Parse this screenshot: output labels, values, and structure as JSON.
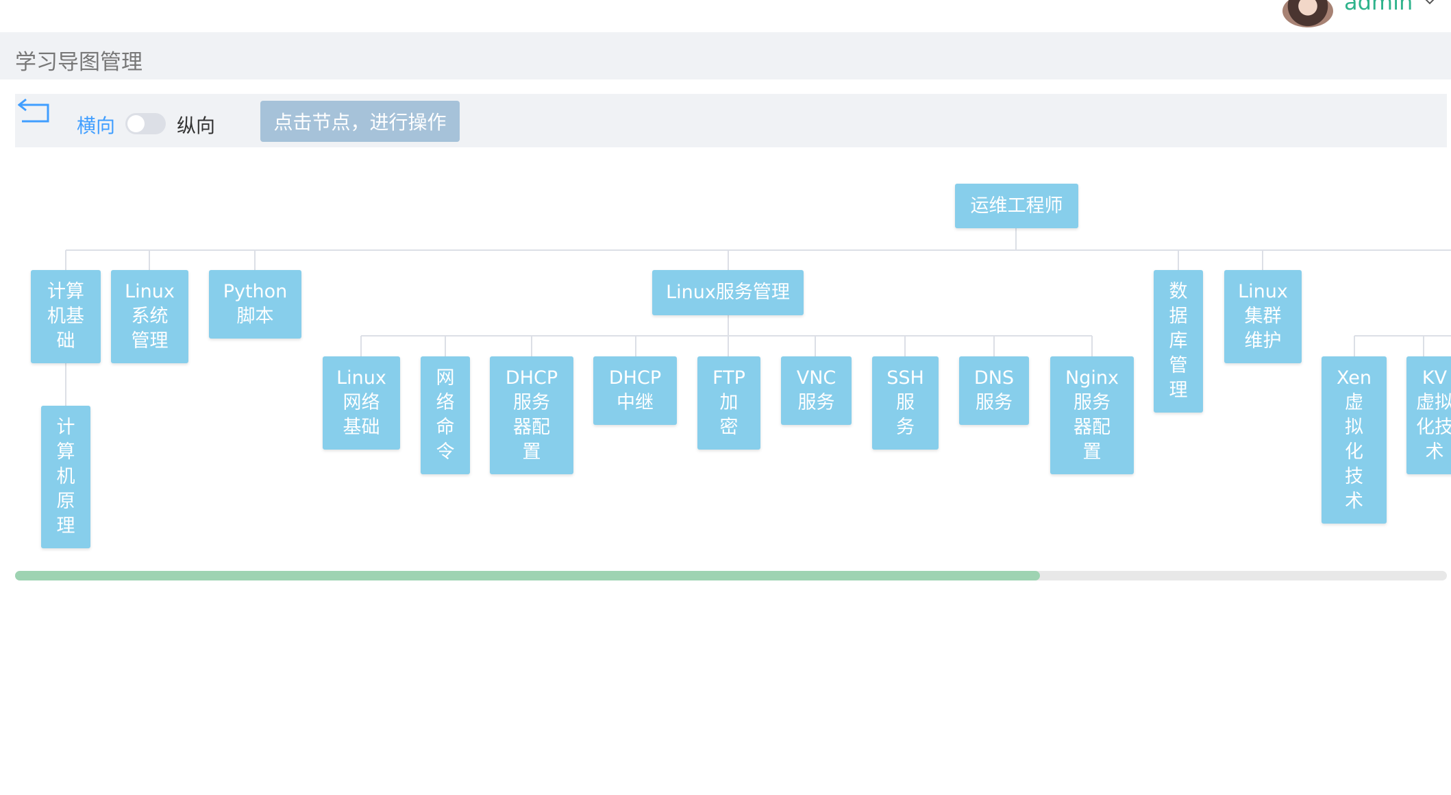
{
  "user": {
    "name": "admin"
  },
  "header": {
    "title": "学习导图管理"
  },
  "toolbar": {
    "horizontal_label": "横向",
    "vertical_label": "纵向",
    "hint": "点击节点，进行操作",
    "orientation_switch_on": false
  },
  "mindmap": {
    "root": "运维工程师",
    "nodes": {
      "computer_basics": "计算\n机基\n础",
      "computer_principles": "计\n算\n机\n原\n理",
      "linux_system": "Linux\n系统\n管理",
      "python": "Python\n脚本",
      "linux_services": "Linux服务管理",
      "linux_network": "Linux\n网络\n基础",
      "network_commands": "网\n络\n命\n令",
      "dhcp_server": "DHCP\n服务\n器配\n置",
      "dhcp_relay": "DHCP\n中继",
      "ftp": "FTP\n加\n密",
      "vnc": "VNC\n服务",
      "ssh": "SSH\n服\n务",
      "dns": "DNS\n服务",
      "nginx": "Nginx\n服务\n器配\n置",
      "database": "数\n据\n库\n管\n理",
      "linux_cluster": "Linux\n集群\n维护",
      "xen": "Xen\n虚\n拟\n化\n技\n术",
      "kvm": "KV\n虚拟\n化技\n术"
    }
  },
  "scroll": {
    "fraction_visible": 0.716
  }
}
